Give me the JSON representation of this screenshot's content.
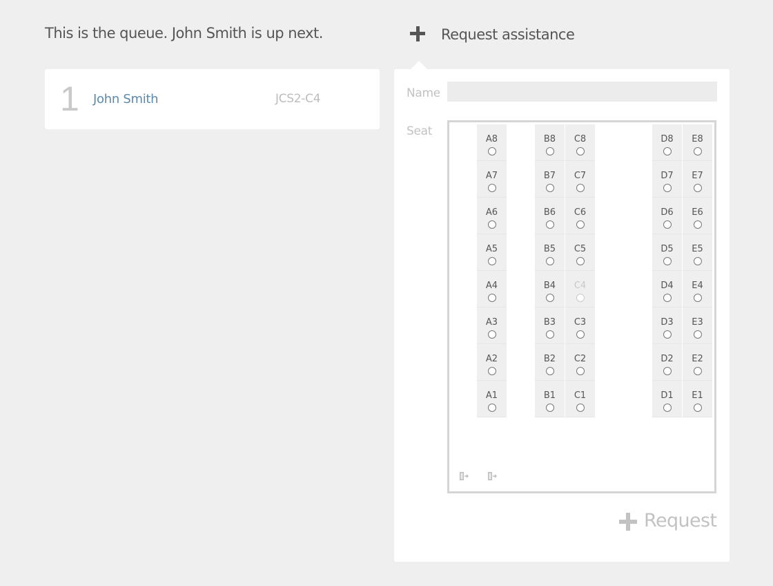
{
  "queue": {
    "heading": "This is the queue. John Smith is up next.",
    "entries": [
      {
        "position": "1",
        "name": "John Smith",
        "seat": "JCS2-C4"
      }
    ]
  },
  "request_panel": {
    "title": "Request assistance",
    "title_icon": "plus-icon",
    "name_label": "Name",
    "name_value": "",
    "seat_label": "Seat",
    "exit_icon": "exit-door-icon",
    "submit_label": "Request",
    "submit_icon": "plus-icon"
  },
  "seat_map": {
    "columns": [
      {
        "id": "A",
        "seats": [
          {
            "label": "A8",
            "disabled": false
          },
          {
            "label": "A7",
            "disabled": false
          },
          {
            "label": "A6",
            "disabled": false
          },
          {
            "label": "A5",
            "disabled": false
          },
          {
            "label": "A4",
            "disabled": false
          },
          {
            "label": "A3",
            "disabled": false
          },
          {
            "label": "A2",
            "disabled": false
          },
          {
            "label": "A1",
            "disabled": false
          }
        ]
      },
      {
        "id": "B",
        "seats": [
          {
            "label": "B8",
            "disabled": false
          },
          {
            "label": "B7",
            "disabled": false
          },
          {
            "label": "B6",
            "disabled": false
          },
          {
            "label": "B5",
            "disabled": false
          },
          {
            "label": "B4",
            "disabled": false
          },
          {
            "label": "B3",
            "disabled": false
          },
          {
            "label": "B2",
            "disabled": false
          },
          {
            "label": "B1",
            "disabled": false
          }
        ]
      },
      {
        "id": "C",
        "seats": [
          {
            "label": "C8",
            "disabled": false
          },
          {
            "label": "C7",
            "disabled": false
          },
          {
            "label": "C6",
            "disabled": false
          },
          {
            "label": "C5",
            "disabled": false
          },
          {
            "label": "C4",
            "disabled": true
          },
          {
            "label": "C3",
            "disabled": false
          },
          {
            "label": "C2",
            "disabled": false
          },
          {
            "label": "C1",
            "disabled": false
          }
        ]
      },
      {
        "id": "D",
        "seats": [
          {
            "label": "D8",
            "disabled": false
          },
          {
            "label": "D7",
            "disabled": false
          },
          {
            "label": "D6",
            "disabled": false
          },
          {
            "label": "D5",
            "disabled": false
          },
          {
            "label": "D4",
            "disabled": false
          },
          {
            "label": "D3",
            "disabled": false
          },
          {
            "label": "D2",
            "disabled": false
          },
          {
            "label": "D1",
            "disabled": false
          }
        ]
      },
      {
        "id": "E",
        "seats": [
          {
            "label": "E8",
            "disabled": false
          },
          {
            "label": "E7",
            "disabled": false
          },
          {
            "label": "E6",
            "disabled": false
          },
          {
            "label": "E5",
            "disabled": false
          },
          {
            "label": "E4",
            "disabled": false
          },
          {
            "label": "E3",
            "disabled": false
          },
          {
            "label": "E2",
            "disabled": false
          },
          {
            "label": "E1",
            "disabled": false
          }
        ]
      }
    ]
  },
  "colors": {
    "background": "#efefef",
    "link": "#5b89ad",
    "muted": "#c2c2c2",
    "text": "#555555"
  }
}
